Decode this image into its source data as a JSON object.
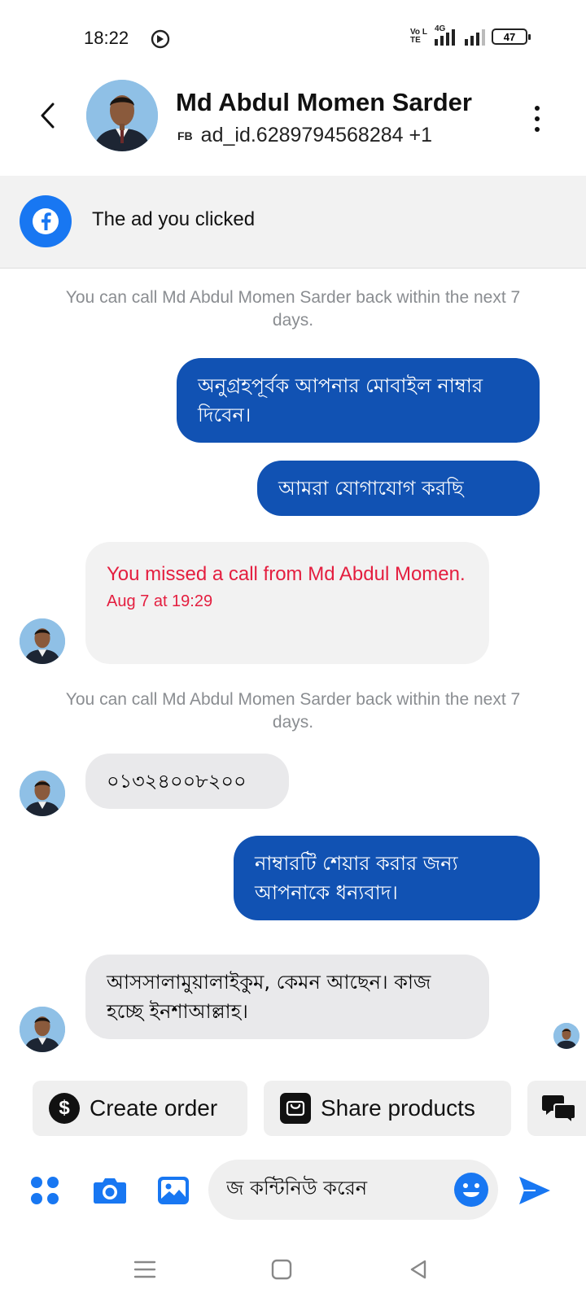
{
  "status_bar": {
    "time": "18:22",
    "volte": "Vo LTE",
    "network": "4G",
    "battery": "47",
    "icons": [
      "dnd-icon",
      "signal-icon",
      "battery-icon"
    ]
  },
  "header": {
    "name": "Md Abdul Momen Sarder",
    "fb_tag": "FB",
    "subtitle": "ad_id.6289794568284 +1"
  },
  "ad_banner": {
    "label": "The ad you clicked"
  },
  "messages": {
    "callback_note_1": "You can call Md Abdul Momen Sarder back within the next 7 days.",
    "out_1": "অনুগ্রহপূর্বক আপনার মোবাইল নাম্বার দিবেন।",
    "out_2": "আমরা যোগাযোগ করছি",
    "missed_call_title": "You missed a call from Md Abdul Momen.",
    "missed_call_time": "Aug 7 at 19:29",
    "callback_note_2": "You can call Md Abdul Momen Sarder back within the next 7 days.",
    "in_1": "০১৩২৪০০৮২০০",
    "out_3": "নাম্বারটি শেয়ার করার জন্য আপনাকে ধন্যবাদ।",
    "in_2": "আসসালামুয়ালাইকুম, কেমন আছেন। কাজ হচ্ছে ইনশাআল্লাহ।"
  },
  "quick_actions": {
    "create_order": "Create order",
    "create_order_symbol": "$",
    "share_products": "Share products"
  },
  "composer": {
    "input_value": "জ কন্টিনিউ করেন"
  },
  "colors": {
    "outgoing_bubble": "#1152b3",
    "incoming_bubble": "#e9e9eb",
    "accent": "#1877f2",
    "missed_call": "#e41e3f"
  }
}
